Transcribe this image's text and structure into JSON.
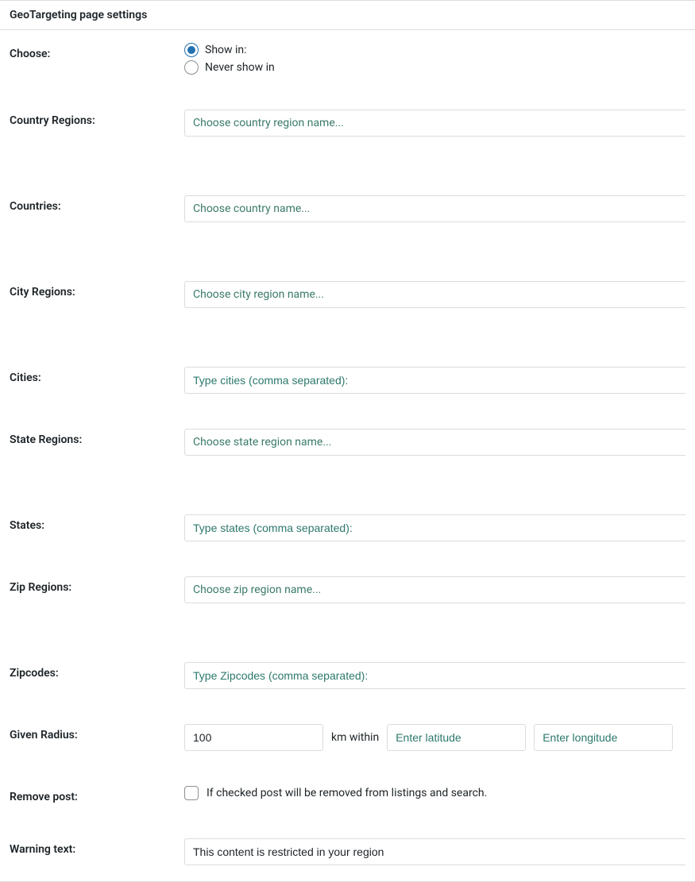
{
  "header": {
    "title": "GeoTargeting page settings"
  },
  "choose": {
    "label": "Choose:",
    "options": {
      "show_in": {
        "label": "Show in:",
        "checked": true
      },
      "never_show_in": {
        "label": "Never show in",
        "checked": false
      }
    }
  },
  "country_regions": {
    "label": "Country Regions:",
    "placeholder": "Choose country region name..."
  },
  "countries": {
    "label": "Countries:",
    "placeholder": "Choose country name..."
  },
  "city_regions": {
    "label": "City Regions:",
    "placeholder": "Choose city region name..."
  },
  "cities": {
    "label": "Cities:",
    "placeholder": "Type cities (comma separated):"
  },
  "state_regions": {
    "label": "State Regions:",
    "placeholder": "Choose state region name..."
  },
  "states": {
    "label": "States:",
    "placeholder": "Type states (comma separated):"
  },
  "zip_regions": {
    "label": "Zip Regions:",
    "placeholder": "Choose zip region name..."
  },
  "zipcodes": {
    "label": "Zipcodes:",
    "placeholder": "Type Zipcodes (comma separated):"
  },
  "radius": {
    "label": "Given Radius:",
    "value": "100",
    "unit_text": "km within",
    "lat_placeholder": "Enter latitude",
    "lon_placeholder": "Enter longitude"
  },
  "remove_post": {
    "label": "Remove post:",
    "checked": false,
    "description": "If checked post will be removed from listings and search."
  },
  "warning_text": {
    "label": "Warning text:",
    "value": "This content is restricted in your region"
  }
}
